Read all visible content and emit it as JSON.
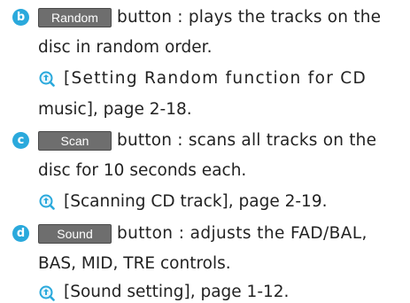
{
  "accent_color": "#2aa9dc",
  "button_color": "#6e6e6e",
  "entries": [
    {
      "marker": "b",
      "button_label": "Random",
      "line1": "button : plays the tracks on the",
      "line2": "disc in random order.",
      "ref_icon": "magnifier-reference-icon",
      "ref_line1": "[Setting Random function for CD",
      "ref_line2": "music], page 2-18."
    },
    {
      "marker": "c",
      "button_label": "Scan",
      "line1": "button : scans all tracks on the",
      "line2": "disc for 10 seconds each.",
      "ref_icon": "magnifier-reference-icon",
      "ref_line1": "[Scanning CD track], page 2-19."
    },
    {
      "marker": "d",
      "button_label": "Sound",
      "line1": "button : adjusts the FAD/BAL,",
      "line2": "BAS, MID, TRE controls.",
      "ref_icon": "magnifier-reference-icon",
      "ref_line1": "[Sound setting], page 1-12."
    }
  ]
}
